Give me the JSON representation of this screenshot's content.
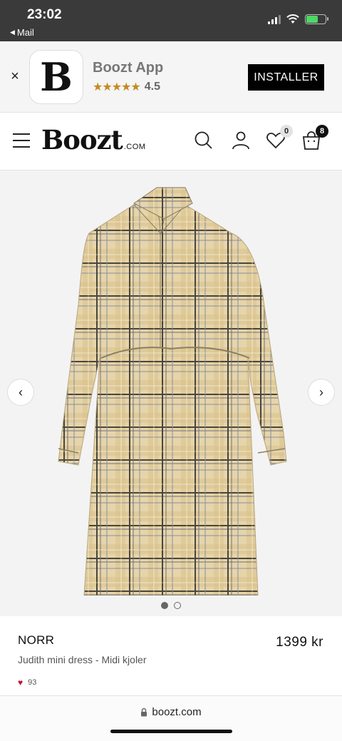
{
  "status_bar": {
    "time": "23:02",
    "back_label": "Mail",
    "battery_color": "#4cd964"
  },
  "app_banner": {
    "close_glyph": "×",
    "logo_letter": "B",
    "app_name": "Boozt App",
    "stars": "★★★★★",
    "rating": "4.5",
    "install_label": "INSTALLER"
  },
  "header": {
    "logo": "Boozt",
    "logo_suffix": ".COM",
    "wishlist_count": "0",
    "cart_count": "8"
  },
  "gallery": {
    "image_subject": "plaid mini shirt dress",
    "prev_glyph": "‹",
    "next_glyph": "›",
    "slide_count": 2,
    "active_slide": 1
  },
  "product": {
    "brand": "NORR",
    "price": "1399 kr",
    "title": "Judith mini dress - Midi kjoler",
    "likes": "93",
    "heart_glyph": "♥",
    "heart_color": "#c8102e"
  },
  "browser": {
    "url": "boozt.com",
    "lock_icon": "lock-icon"
  }
}
